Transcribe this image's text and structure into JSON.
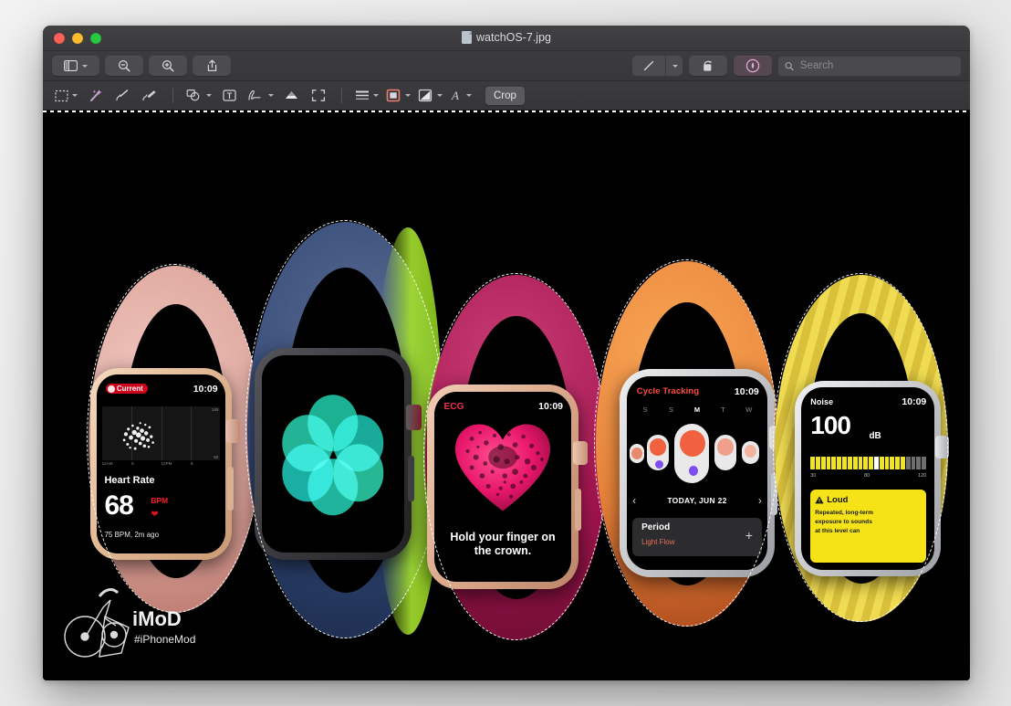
{
  "window": {
    "title": "watchOS-7.jpg",
    "traffic_lights": [
      "close",
      "minimize",
      "zoom"
    ]
  },
  "toolbar": {
    "sidebar_label": "Sidebar",
    "zoom_out_label": "Zoom Out",
    "zoom_in_label": "Zoom In",
    "share_label": "Share",
    "markup_label": "Markup",
    "rotate_label": "Rotate Left",
    "annotate_label": "Annotate",
    "search": {
      "placeholder": "Search",
      "value": ""
    }
  },
  "markup_toolbar": {
    "tools": [
      {
        "name": "selection-tool",
        "label": "Selection Tools",
        "has_caret": true
      },
      {
        "name": "instant-alpha-tool",
        "label": "Instant Alpha",
        "has_caret": false
      },
      {
        "name": "sketch-tool",
        "label": "Sketch",
        "has_caret": false
      },
      {
        "name": "draw-tool",
        "label": "Draw",
        "has_caret": false
      },
      {
        "name": "shapes-tool",
        "label": "Shapes",
        "has_caret": true
      },
      {
        "name": "text-tool",
        "label": "Text",
        "has_caret": false
      },
      {
        "name": "sign-tool",
        "label": "Sign",
        "has_caret": true
      },
      {
        "name": "adjust-color-tool",
        "label": "Adjust Color",
        "has_caret": false
      },
      {
        "name": "adjust-size-tool",
        "label": "Adjust Size",
        "has_caret": false
      },
      {
        "name": "shape-style-tool",
        "label": "Shape Style",
        "has_caret": true
      },
      {
        "name": "border-color-tool",
        "label": "Border Color",
        "has_caret": true
      },
      {
        "name": "fill-color-tool",
        "label": "Fill Color",
        "has_caret": true
      },
      {
        "name": "text-style-tool",
        "label": "Text Style",
        "has_caret": true
      }
    ],
    "crop_label": "Crop"
  },
  "image": {
    "background_color": "#000000",
    "watermark": {
      "brand": "iMoD",
      "handle": "#iPhoneMod"
    },
    "watches": [
      {
        "id": "heart-rate",
        "band_color": "#e5b2ad",
        "case_color": "#e7c3a6",
        "face": {
          "badge": "Current",
          "time": "10:09",
          "chart_max": "140",
          "chart_min": "62",
          "x_ticks": [
            "12AM",
            "6",
            "12PM",
            "6"
          ],
          "label": "Heart Rate",
          "value": "68",
          "unit": "BPM",
          "subtitle": "75 BPM, 2m ago",
          "accent": "#f5222d"
        }
      },
      {
        "id": "breathe",
        "band_color": "#2d4a7a",
        "band_accent": "#a6e22e",
        "case_color": "#3a3a3c",
        "face": {
          "app": "Breathe",
          "accent": "#2ce8c0"
        }
      },
      {
        "id": "ecg",
        "band_color": "#b8174a",
        "case_color": "#d9a38a",
        "face": {
          "title": "ECG",
          "time": "10:09",
          "message_line1": "Hold your finger on",
          "message_line2": "the crown.",
          "accent": "#f5334f"
        }
      },
      {
        "id": "cycle-tracking",
        "band_color": "#f08a3c",
        "case_color": "#c9cacc",
        "face": {
          "title": "Cycle Tracking",
          "time": "10:09",
          "days": [
            "S",
            "S",
            "M",
            "T",
            "W"
          ],
          "today_index": 2,
          "date": "TODAY, JUN 22",
          "prev_label": "‹",
          "next_label": "›",
          "card_title": "Period",
          "card_subtitle": "Light Flow",
          "add_label": "+",
          "accent": "#ff4d3d"
        }
      },
      {
        "id": "noise",
        "band_color": "#e8d24a",
        "case_color": "#cfd0d2",
        "face": {
          "title": "Noise",
          "time": "10:09",
          "value": "100",
          "unit": "dB",
          "scale": [
            "30",
            "80",
            "120"
          ],
          "alert_title": "Loud",
          "alert_body_lines": [
            "Repeated, long-term",
            "exposure to sounds",
            "at this level can"
          ],
          "alert_color": "#f5e318"
        }
      }
    ]
  }
}
